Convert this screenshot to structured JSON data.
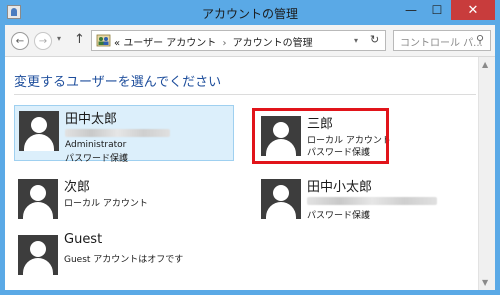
{
  "window": {
    "title": "アカウントの管理",
    "minimize": "—",
    "maximize": "☐",
    "close": "✕"
  },
  "nav": {
    "back_icon": "←",
    "forward_icon": "→",
    "history_icon": "▾",
    "up_icon": "↑",
    "address": {
      "prefix": "«",
      "crumb1": "ユーザー アカウント",
      "sep": "›",
      "crumb2": "アカウントの管理",
      "dropdown": "▾",
      "refresh": "↻"
    },
    "search": {
      "placeholder": "コントロール パ...",
      "icon": "🔍"
    }
  },
  "content": {
    "heading": "変更するユーザーを選んでください",
    "accounts": [
      {
        "name": "田中太郎",
        "type": "Administrator",
        "protection": "パスワード保護",
        "selected": true
      },
      {
        "name": "三郎",
        "type": "ローカル アカウント",
        "protection": "パスワード保護",
        "selected": false
      },
      {
        "name": "次郎",
        "type": "ローカル アカウント",
        "protection": "",
        "selected": false
      },
      {
        "name": "田中小太郎",
        "type": "",
        "protection": "パスワード保護",
        "selected": false
      },
      {
        "name": "Guest",
        "type": "Guest アカウントはオフです",
        "protection": "",
        "selected": false
      }
    ]
  },
  "colors": {
    "titlebar": "#5aa9e6",
    "close": "#c83c3c",
    "heading": "#1e4e9c",
    "selected_bg": "#dceffb",
    "highlight": "#e1141a"
  }
}
